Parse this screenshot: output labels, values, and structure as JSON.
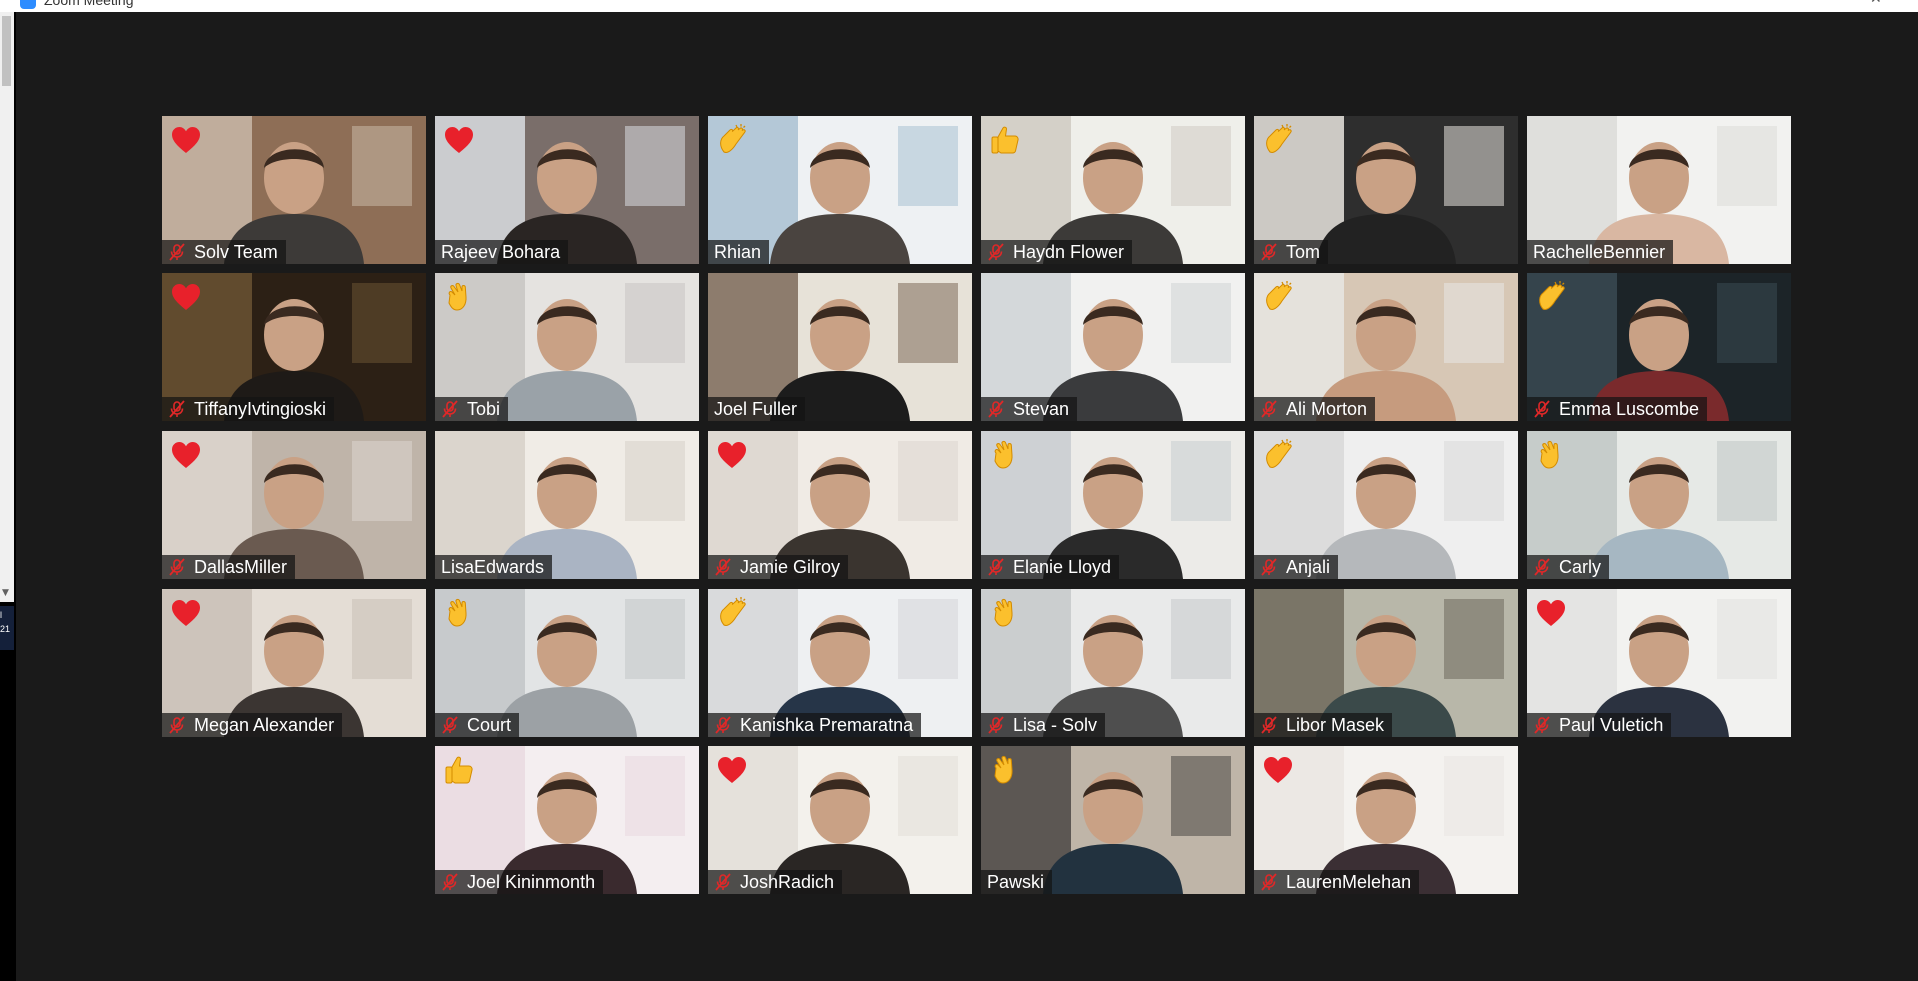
{
  "window": {
    "title": "Zoom Meeting"
  },
  "left_strip": {
    "line1": "l",
    "line2": "21"
  },
  "colors": {
    "active_speaker": "#d9ec5a",
    "mute": "#e02828",
    "heart": "#e8212b",
    "hand": "#fbc02d"
  },
  "participants": [
    {
      "name": "Solv Team",
      "muted": true,
      "reaction": "heart"
    },
    {
      "name": "Rajeev Bohara",
      "muted": false,
      "reaction": "heart"
    },
    {
      "name": "Rhian",
      "muted": false,
      "reaction": "clap"
    },
    {
      "name": "Haydn Flower",
      "muted": true,
      "reaction": "thumbs-up"
    },
    {
      "name": "Tom",
      "muted": true,
      "reaction": "clap"
    },
    {
      "name": "RachelleBennier",
      "muted": false,
      "reaction": ""
    },
    {
      "name": "TiffanyIvtingioski",
      "muted": true,
      "reaction": "heart"
    },
    {
      "name": "Tobi",
      "muted": true,
      "reaction": "wave"
    },
    {
      "name": "Joel Fuller",
      "muted": false,
      "reaction": "",
      "active": true
    },
    {
      "name": "Stevan",
      "muted": true,
      "reaction": ""
    },
    {
      "name": "Ali Morton",
      "muted": true,
      "reaction": "clap"
    },
    {
      "name": "Emma Luscombe",
      "muted": true,
      "reaction": "clap"
    },
    {
      "name": "DallasMiller",
      "muted": true,
      "reaction": "heart"
    },
    {
      "name": "LisaEdwards",
      "muted": false,
      "reaction": ""
    },
    {
      "name": "Jamie Gilroy",
      "muted": true,
      "reaction": "heart"
    },
    {
      "name": "Elanie Lloyd",
      "muted": true,
      "reaction": "wave"
    },
    {
      "name": "Anjali",
      "muted": true,
      "reaction": "clap"
    },
    {
      "name": "Carly",
      "muted": true,
      "reaction": "wave"
    },
    {
      "name": "Megan Alexander",
      "muted": true,
      "reaction": "heart"
    },
    {
      "name": "Court",
      "muted": true,
      "reaction": "wave"
    },
    {
      "name": "Kanishka Premaratna",
      "muted": true,
      "reaction": "clap"
    },
    {
      "name": "Lisa - Solv",
      "muted": true,
      "reaction": "wave"
    },
    {
      "name": "Libor Masek",
      "muted": true,
      "reaction": ""
    },
    {
      "name": "Paul Vuletich",
      "muted": true,
      "reaction": "heart"
    },
    {
      "name": "Joel Kininmonth",
      "muted": true,
      "reaction": "thumbs-up"
    },
    {
      "name": "JoshRadich",
      "muted": true,
      "reaction": "heart"
    },
    {
      "name": "Pawski",
      "muted": false,
      "reaction": "wave"
    },
    {
      "name": "LaurenMelehan",
      "muted": true,
      "reaction": "heart"
    }
  ]
}
